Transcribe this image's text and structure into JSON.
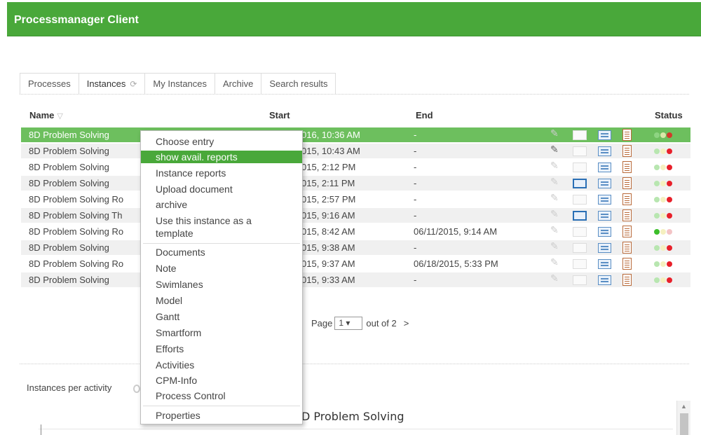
{
  "app": {
    "title": "Processmanager Client"
  },
  "tabs": [
    {
      "label": "Processes"
    },
    {
      "label": "Instances"
    },
    {
      "label": "My Instances"
    },
    {
      "label": "Archive"
    },
    {
      "label": "Search results"
    }
  ],
  "table": {
    "columns": {
      "name": "Name",
      "start": "Start",
      "end": "End",
      "status": "Status"
    },
    "rows": [
      {
        "name": "8D Problem Solving",
        "start": "016, 10:36 AM",
        "end": "-"
      },
      {
        "name": "8D Problem Solving",
        "start": "015, 10:43 AM",
        "end": "-"
      },
      {
        "name": "8D Problem Solving",
        "start": "015, 2:12 PM",
        "end": "-"
      },
      {
        "name": "8D Problem Solving",
        "start": "015, 2:11 PM",
        "end": "-"
      },
      {
        "name": "8D Problem Solving Ro",
        "start": "015, 2:57 PM",
        "end": "-"
      },
      {
        "name": "8D Problem Solving Th",
        "start": "015, 9:16 AM",
        "end": "-"
      },
      {
        "name": "8D Problem Solving Ro",
        "start": "015, 8:42 AM",
        "end": "06/11/2015, 9:14 AM"
      },
      {
        "name": "8D Problem Solving",
        "start": "015, 9:38 AM",
        "end": "-"
      },
      {
        "name": "8D Problem Solving Ro",
        "start": "015, 9:37 AM",
        "end": "06/18/2015, 5:33 PM"
      },
      {
        "name": "8D Problem Solving",
        "start": "015, 9:33 AM",
        "end": "-"
      }
    ]
  },
  "pager": {
    "page_label": "Page",
    "page_value": "1 ▾",
    "out_of": "out of 2",
    "next": ">"
  },
  "bottom": {
    "instances_per_activity": "Instances per activity",
    "chart_title": "D Problem Solving"
  },
  "context_menu": {
    "items": [
      "Choose entry",
      "show avail. reports",
      "Instance reports",
      "Upload document",
      "archive",
      "Use this instance as a template",
      "Documents",
      "Note",
      "Swimlanes",
      "Model",
      "Gantt",
      "Smartform",
      "Efforts",
      "Activities",
      "CPM-Info",
      "Process Control",
      "Properties"
    ]
  },
  "colors": {
    "brand_green": "#49a83a",
    "selected_row": "#6dbf5e",
    "status_red": "#e8202a"
  },
  "icons": [
    "paperclip-icon",
    "book-icon",
    "card-icon",
    "document-icon",
    "traffic-light-icon",
    "funnel-icon",
    "refresh-icon"
  ]
}
